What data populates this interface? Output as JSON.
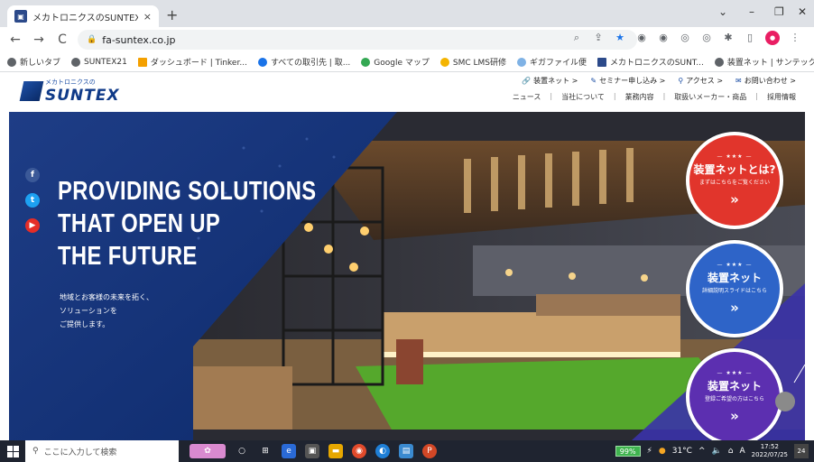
{
  "browser": {
    "tab_title": "メカトロニクスのSUNTEX",
    "tab_close": "×",
    "new_tab": "+",
    "window_controls": [
      "⌄",
      "–",
      "❐",
      "✕"
    ],
    "nav": {
      "back": "←",
      "forward": "→",
      "reload": "C"
    },
    "url": "fa-suntex.co.jp",
    "bookmarks": [
      {
        "label": "新しいタブ",
        "color": "#5f6368"
      },
      {
        "label": "SUNTEX21",
        "color": "#5f6368"
      },
      {
        "label": "ダッシュボード | Tinker...",
        "color": "#f4a000"
      },
      {
        "label": "すべての取引先 | 取...",
        "color": "#1a73e8"
      },
      {
        "label": "Google マップ",
        "color": "#34a853"
      },
      {
        "label": "SMC LMS研修",
        "color": "#f4b400"
      },
      {
        "label": "ギガファイル便",
        "color": "#7fb2e5"
      },
      {
        "label": "メカトロニクスのSUNT...",
        "color": "#2c4a8a"
      },
      {
        "label": "装置ネット | サンテックス",
        "color": "#5f6368"
      }
    ]
  },
  "site": {
    "logo_sub": "メカトロニクスの",
    "logo_main": "SUNTEX",
    "topnav": [
      {
        "icon": "🔗",
        "label": "装置ネット >"
      },
      {
        "icon": "✎",
        "label": "セミナー申し込み >"
      },
      {
        "icon": "⚲",
        "label": "アクセス >"
      },
      {
        "icon": "✉",
        "label": "お問い合わせ >"
      }
    ],
    "subnav": [
      "ニュース",
      "当社について",
      "業務内容",
      "取扱いメーカー・商品",
      "採用情報"
    ]
  },
  "hero": {
    "title_lines": [
      "PROVIDING SOLUTIONS",
      "THAT OPEN UP",
      "THE FUTURE"
    ],
    "subtitle_lines": [
      "地域とお客様の未来を拓く、",
      "ソリューションを",
      "ご提供します。"
    ],
    "social": [
      {
        "name": "facebook",
        "glyph": "f",
        "color": "#3b5998"
      },
      {
        "name": "twitter",
        "glyph": "t",
        "color": "#1da1f2"
      },
      {
        "name": "youtube",
        "glyph": "▶",
        "color": "#e52d27"
      }
    ],
    "circles": [
      {
        "stars": "— ★★★ —",
        "title": "装置ネットとは?",
        "sub": "まずはこちらをご覧ください",
        "arrow": "»",
        "color": "red"
      },
      {
        "stars": "— ★★★ —",
        "title": "装置ネット",
        "sub": "詳細説明スライドはこちら",
        "arrow": "»",
        "color": "blue"
      },
      {
        "stars": "— ★★★ —",
        "title": "装置ネット",
        "sub": "登録ご希望の方はこちら",
        "arrow": "»",
        "color": "purple"
      }
    ]
  },
  "taskbar": {
    "search_placeholder": "ここに入力して検索",
    "battery": "99%",
    "temperature": "31°C",
    "ime": "A",
    "time": "17:52",
    "date": "2022/07/25",
    "notifications": "24"
  }
}
